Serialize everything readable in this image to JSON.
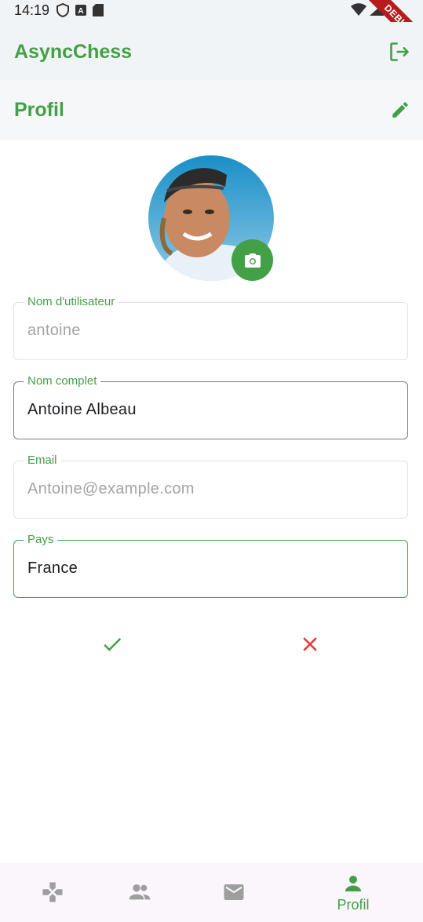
{
  "status_bar": {
    "time": "14:19",
    "debug_label": "DEBUG"
  },
  "app_bar": {
    "title": "AsyncChess",
    "logout_icon": "logout-icon"
  },
  "section": {
    "title": "Profil",
    "edit_icon": "pencil-icon"
  },
  "avatar": {
    "camera_icon": "camera-icon"
  },
  "form": {
    "fields": [
      {
        "label": "Nom d'utilisateur",
        "value": "antoine",
        "state": "disabled"
      },
      {
        "label": "Nom complet",
        "value": "Antoine Albeau",
        "state": "enabled"
      },
      {
        "label": "Email",
        "value": "Antoine@example.com",
        "state": "disabled"
      },
      {
        "label": "Pays",
        "value": "France",
        "state": "focused"
      }
    ]
  },
  "actions": {
    "confirm_icon": "check-icon",
    "cancel_icon": "close-icon"
  },
  "bottom_nav": {
    "items": [
      {
        "icon": "gamepad-icon",
        "label": ""
      },
      {
        "icon": "people-icon",
        "label": ""
      },
      {
        "icon": "mail-icon",
        "label": ""
      },
      {
        "icon": "person-icon",
        "label": "Profil",
        "active": true
      }
    ]
  },
  "colors": {
    "accent": "#43a047",
    "cancel": "#e53935",
    "inactive_icon": "#9e9e9e"
  }
}
